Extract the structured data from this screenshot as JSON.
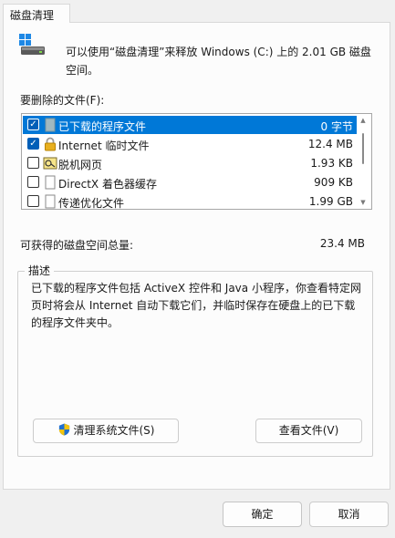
{
  "tab": {
    "label": "磁盘清理"
  },
  "intro": "可以使用“磁盘清理”来释放 Windows (C:) 上的 2.01 GB 磁盘空间。",
  "list_label": "要删除的文件(F):",
  "files": [
    {
      "name": "已下载的程序文件",
      "size": "0 字节",
      "checked": true,
      "selected": true,
      "icon": "blank-file-icon"
    },
    {
      "name": "Internet 临时文件",
      "size": "12.4 MB",
      "checked": true,
      "selected": false,
      "icon": "lock-icon"
    },
    {
      "name": "脱机网页",
      "size": "1.93 KB",
      "checked": false,
      "selected": false,
      "icon": "offline-page-icon"
    },
    {
      "name": "DirectX 着色器缓存",
      "size": "909 KB",
      "checked": false,
      "selected": false,
      "icon": "file-icon"
    },
    {
      "name": "传递优化文件",
      "size": "1.99 GB",
      "checked": false,
      "selected": false,
      "icon": "file-icon"
    }
  ],
  "total": {
    "label": "可获得的磁盘空间总量:",
    "value": "23.4 MB"
  },
  "description": {
    "title": "描述",
    "text": "已下载的程序文件包括 ActiveX 控件和 Java 小程序，你查看特定网页时将会从 Internet 自动下载它们，并临时保存在硬盘上的已下载的程序文件夹中。"
  },
  "buttons": {
    "clean_system": "清理系统文件(S)",
    "view_files": "查看文件(V)",
    "ok": "确定",
    "cancel": "取消"
  },
  "colors": {
    "selection": "#0078d7",
    "checkbox": "#005fb8"
  }
}
